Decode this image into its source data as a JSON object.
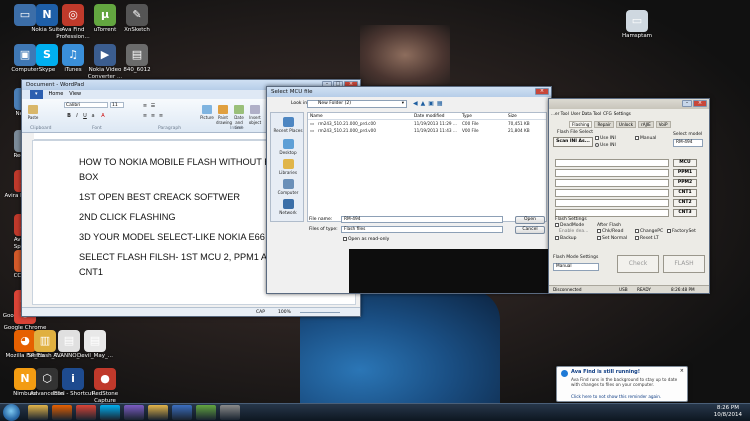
{
  "desktop_icons": [
    {
      "label": "",
      "color": "#3c6ea8",
      "glyph": "▭"
    },
    {
      "label": "Nokia Suite",
      "color": "#1e5fa8",
      "glyph": "N"
    },
    {
      "label": "Ava Find Profession...",
      "color": "#c03a2b",
      "glyph": "◎"
    },
    {
      "label": "uTorrent",
      "color": "#63a640",
      "glyph": "µ"
    },
    {
      "label": "XnSketch",
      "color": "#555555",
      "glyph": "✎"
    },
    {
      "label": "Computer",
      "color": "#3f78b5",
      "glyph": "▣"
    },
    {
      "label": "Skype",
      "color": "#00aff0",
      "glyph": "S"
    },
    {
      "label": "iTunes",
      "color": "#3a8fd9",
      "glyph": "♫"
    },
    {
      "label": "Nokia Video Converter ...",
      "color": "#3b5d8f",
      "glyph": "▶"
    },
    {
      "label": "840_6012",
      "color": "#6b6b6b",
      "glyph": "▤"
    },
    {
      "label": "Netw...",
      "color": "#4b7fb8",
      "glyph": "⌂"
    },
    {
      "label": "Recycl...",
      "color": "#7c8b99",
      "glyph": "♻"
    },
    {
      "label": "Avira Keyboa...",
      "color": "#c0392b",
      "glyph": "A"
    },
    {
      "label": "Avira Sy Speed...",
      "color": "#c0392b",
      "glyph": "A"
    },
    {
      "label": "CCleane",
      "color": "#d45a2a",
      "glyph": "C"
    },
    {
      "label": "Google Chrom...",
      "color": "#db4437",
      "glyph": "◉"
    },
    {
      "label": "Google Chrome",
      "color": "#db4437",
      "glyph": "◉"
    },
    {
      "label": "Mozilla Firefox",
      "color": "#e66000",
      "glyph": "◕"
    },
    {
      "label": "SP_Flash_T...",
      "color": "#e0b040",
      "glyph": "▥"
    },
    {
      "label": "AVANNO_...",
      "color": "#e0e0e0",
      "glyph": "▤"
    },
    {
      "label": "Devil_May_...",
      "color": "#e8e8e8",
      "glyph": "▤"
    },
    {
      "label": "Nimbuzz",
      "color": "#f39c12",
      "glyph": "N"
    },
    {
      "label": "AdvanceElin",
      "color": "#333333",
      "glyph": "⬡"
    },
    {
      "label": "Intel - Shortcut",
      "color": "#1e4b8f",
      "glyph": "i"
    },
    {
      "label": "RedStone Capture",
      "color": "#c0392b",
      "glyph": "●"
    },
    {
      "label": "Hamsptam",
      "color": "#cfd8e0",
      "glyph": "▭"
    }
  ],
  "wordpad": {
    "title": "Document - WordPad",
    "tabs": [
      "Home",
      "View"
    ],
    "font_name": "Calibri",
    "font_size": "11",
    "groups": [
      "Clipboard",
      "Font",
      "Paragraph",
      "Insert",
      "Editing"
    ],
    "insert_items": [
      "Picture",
      "Paint drawing",
      "Date and time",
      "Insert object"
    ],
    "edit_items": [
      "Find",
      "Replace",
      "Select all"
    ],
    "lines": [
      "HOW TO NOKIA MOBILE FLASH WITHOUT FL",
      "BOX",
      "1ST OPEN BEST CREACK SOFTWER",
      "2ND CLICK FLASHING",
      "3D YOUR MODEL SELECT-LIKE NOKIA E66",
      "SELECT FLASH FILSH- 1ST MCU 2, PPM1 AND 3RD",
      "CNT1"
    ],
    "status_caps": "CAP",
    "zoom": "100%"
  },
  "mcu_dialog": {
    "title": "Select MCU file",
    "look_in_label": "Look in:",
    "look_in_value": "New Folder (2)",
    "places": [
      "Recent Places",
      "Desktop",
      "Libraries",
      "Computer",
      "Network"
    ],
    "columns": [
      "Name",
      "Date modified",
      "Type",
      "Size"
    ],
    "files": [
      {
        "name": "rm243_510.21.000_prd.c00",
        "date": "11/19/2013 11:29 ...",
        "type": "C00 File",
        "size": "70,451 KB"
      },
      {
        "name": "rm243_510.21.000_prd.v00",
        "date": "11/19/2013 11:43 ...",
        "type": "V00 File",
        "size": "21,804 KB"
      }
    ],
    "file_name_label": "File name:",
    "file_name_value": "RM-494",
    "file_type_label": "Files of type:",
    "file_type_value": "Flash files",
    "readonly_label": "Open as read-only",
    "open_label": "Open",
    "cancel_label": "Cancel"
  },
  "flash_tool": {
    "tabs": [
      "Flashing",
      "Repair",
      "Unlock",
      "rAJIE",
      "VoiP"
    ],
    "tabs_top": [
      "...er Tool",
      "User Data Tool",
      "CFG",
      "Settings"
    ],
    "flash_file_select": "Flash File Select",
    "scan_label": "Scan INI As...",
    "use_ini": "Use INI",
    "manual": "Manual",
    "use_ini2": "Use INI",
    "select_model": "Select model",
    "model_value": "RM-494",
    "file_buttons": [
      "MCU",
      "PPM1",
      "PPM2",
      "CNT1",
      "CNT2",
      "CNT3"
    ],
    "flash_settings": "Flash Settings",
    "dead_mode": "DeadMode",
    "dead_sub": "Enable dea...",
    "backup": "Backup",
    "after_flash": "After Flash",
    "options": [
      "Chk/Read",
      "ChangePC",
      "FactorySet",
      "Set Normal",
      "Reset LT"
    ],
    "flash_mode_label": "Flash Mode Settings",
    "flash_mode_value": "Manual",
    "check_label": "Check",
    "flash_label": "FLASH",
    "status": [
      "Disconnected",
      "USB",
      "READY",
      "8:26:48 PM"
    ]
  },
  "notification": {
    "title": "Ava Find is still running!",
    "body": "Ava Find runs in the background to stay up to date with changes to files on your computer.",
    "action": "Click here to not show this reminder again."
  },
  "taskbar": {
    "apps": [
      {
        "name": "explorer",
        "color": "#e3b54a"
      },
      {
        "name": "firefox",
        "color": "#e66000"
      },
      {
        "name": "chrome",
        "color": "#db4437"
      },
      {
        "name": "skype",
        "color": "#00aff0"
      },
      {
        "name": "media",
        "color": "#7c5cc4"
      },
      {
        "name": "folder2",
        "color": "#e3b54a"
      },
      {
        "name": "wordpad",
        "color": "#3b6fc0"
      },
      {
        "name": "utorrent",
        "color": "#63a640"
      },
      {
        "name": "app",
        "color": "#8a8a8a"
      }
    ],
    "time": "8:26 PM",
    "date": "10/8/2014"
  }
}
